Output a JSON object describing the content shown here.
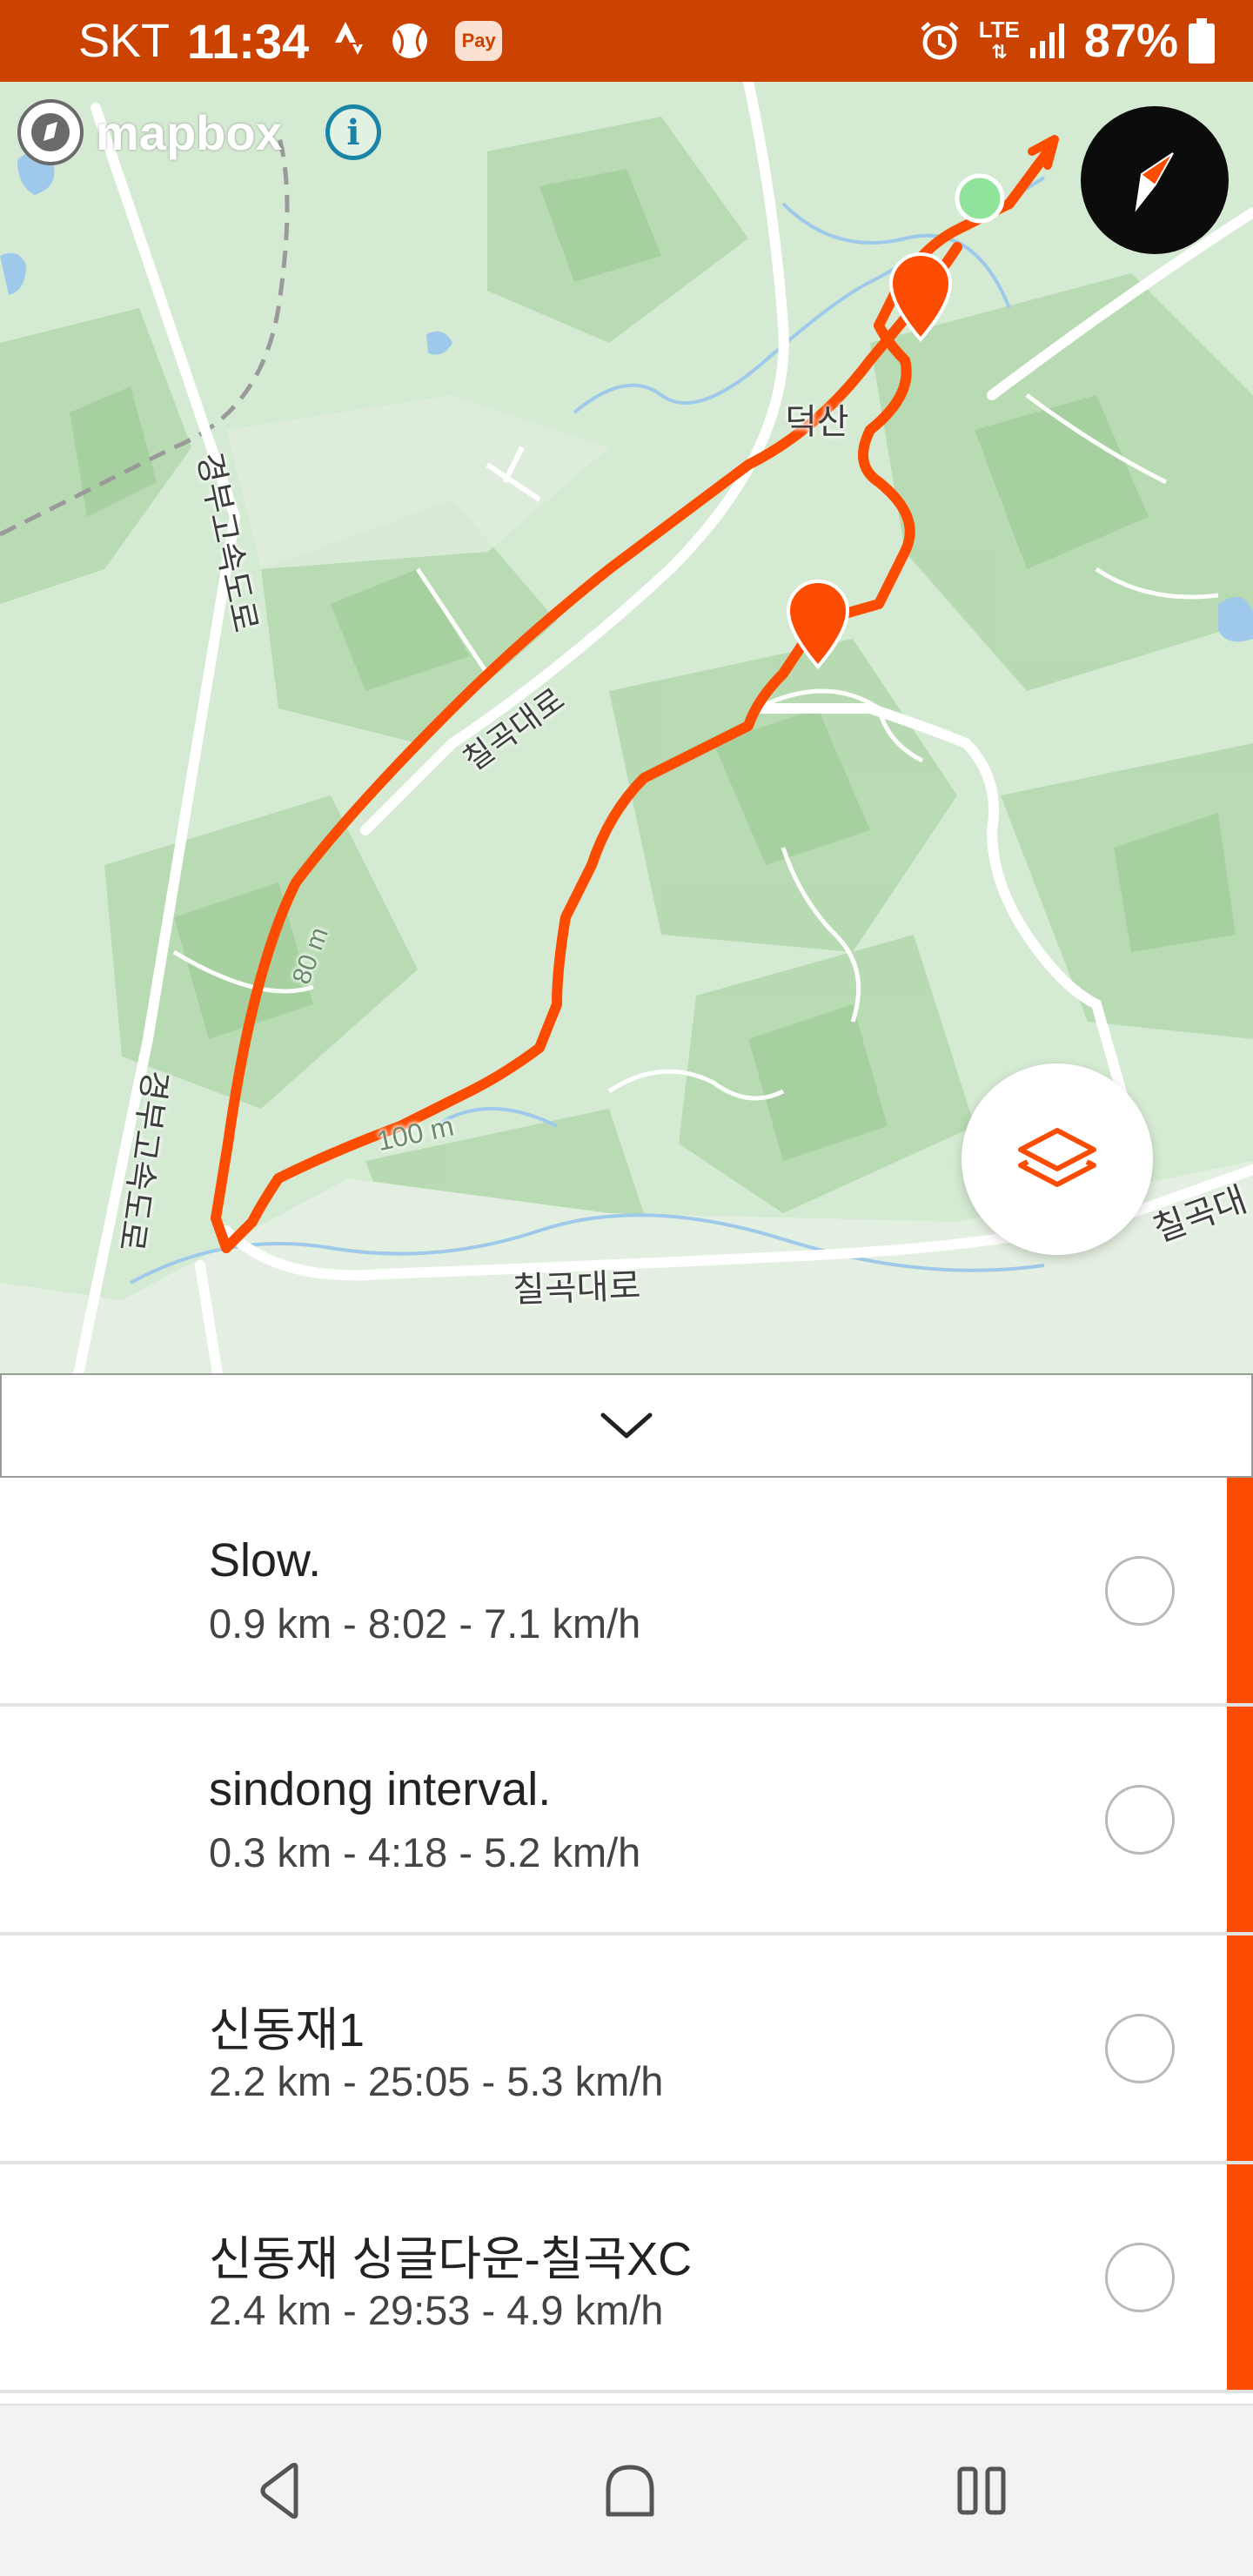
{
  "status_bar": {
    "carrier": "SKT",
    "time": "11:34",
    "icons": [
      "strava-icon",
      "baseball-icon",
      "pay-icon",
      "alarm-icon",
      "lte-icon",
      "signal-icon",
      "battery-icon"
    ],
    "pay_label": "Pay",
    "lte_label": "LTE",
    "battery": "87%"
  },
  "map": {
    "attribution": "mapbox",
    "labels": {
      "expressway_top": "경부고속도로",
      "expressway_bottom": "경부고속도로",
      "chilgok_road_upper": "칠곡대로",
      "chilgok_road_bottom": "칠곡대로",
      "chilgok_road_right": "칠곡대",
      "deoksan": "덕산",
      "contour_100m": "100 m",
      "contour_80m": "80 m"
    },
    "colors": {
      "route": "#fc4c02",
      "start": "#8fe39a",
      "road": "#ffffff",
      "water": "#a9d3f0"
    }
  },
  "collapse": {
    "icon": "chevron-down-icon"
  },
  "segments": [
    {
      "name": "Slow.",
      "stats": "0.9 km - 8:02 - 7.1 km/h"
    },
    {
      "name": "sindong interval.",
      "stats": "0.3 km - 4:18 - 5.2 km/h"
    },
    {
      "name": "신동재1",
      "stats": "2.2 km - 25:05 - 5.3 km/h"
    },
    {
      "name": "신동재 싱글다운-칠곡XC",
      "stats": "2.4 km - 29:53 - 4.9 km/h"
    }
  ],
  "nav": {
    "icons": [
      "back-icon",
      "home-icon",
      "recents-icon"
    ]
  },
  "accent": "#fc4c02",
  "status_bar_color": "#cc4200"
}
